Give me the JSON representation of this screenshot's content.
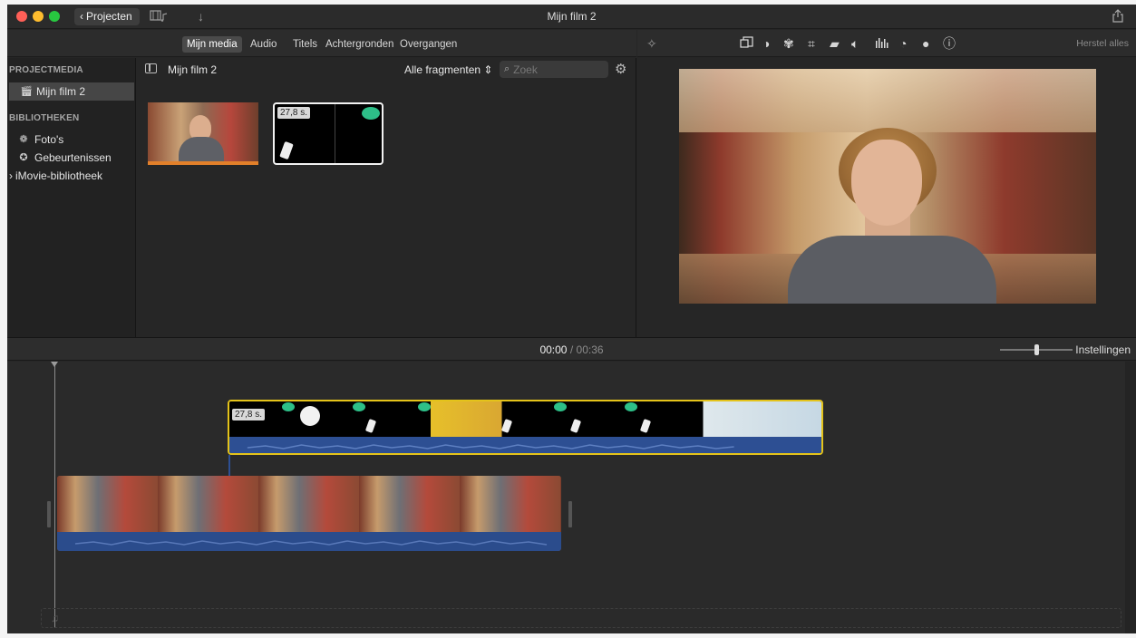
{
  "window": {
    "title": "Mijn film 2"
  },
  "toolbar": {
    "projects_label": "Projecten"
  },
  "tabs": [
    "Mijn media",
    "Audio",
    "Titels",
    "Achtergronden",
    "Overgangen"
  ],
  "viewer_toolbar": {
    "icons": [
      "magic-wand",
      "crop-frame",
      "color-balance",
      "color-palette",
      "crop",
      "stabilization",
      "volume",
      "equalizer",
      "speed",
      "noise-reduction",
      "info"
    ],
    "reset_all": "Herstel alles"
  },
  "sidebar": {
    "project_media_header": "PROJECTMEDIA",
    "project_item": "Mijn film 2",
    "libraries_header": "BIBLIOTHEKEN",
    "items": [
      "Foto's",
      "Gebeurtenissen"
    ],
    "library": "iMovie-bibliotheek"
  },
  "browser": {
    "title": "Mijn film 2",
    "filter": "Alle fragmenten",
    "search_placeholder": "Zoek",
    "clips": [
      {
        "type": "video"
      },
      {
        "type": "graphic",
        "duration": "27,8 s."
      }
    ]
  },
  "timeline": {
    "current_time": "00:00",
    "separator": "/",
    "total_time": "00:36",
    "settings_label": "Instellingen",
    "connected_clip_duration": "27,8 s."
  },
  "colors": {
    "accent_selected": "#e4c31a",
    "audio": "#2d4f93"
  }
}
